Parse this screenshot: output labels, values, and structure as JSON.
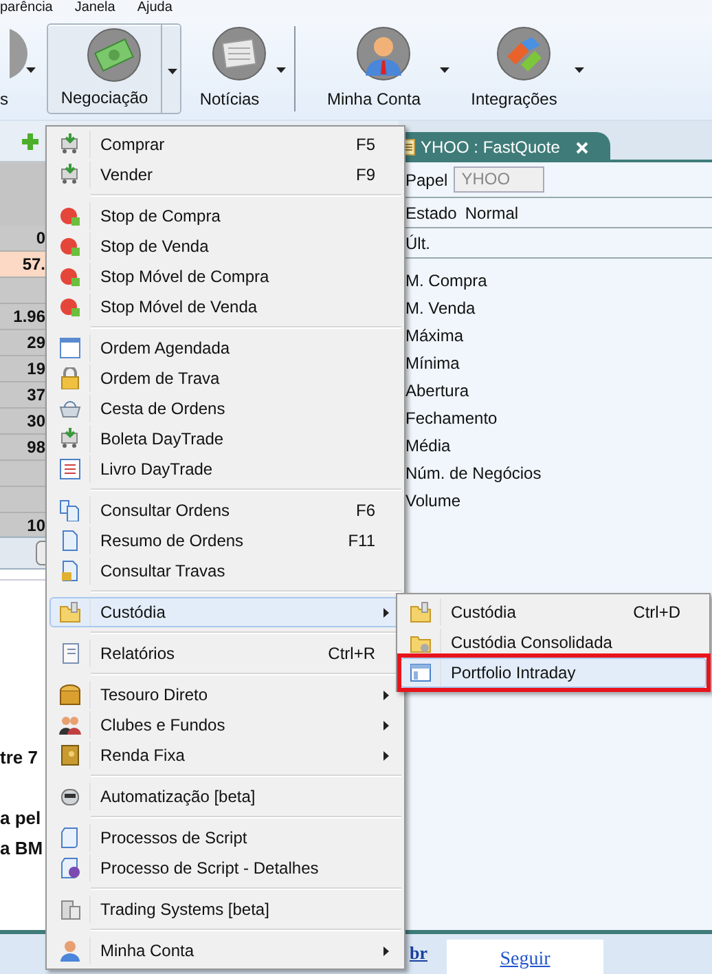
{
  "menu_bar": [
    "parência",
    "Janela",
    "Ajuda"
  ],
  "toolbar": [
    {
      "label": "s",
      "selected": false
    },
    {
      "label": "Negociação",
      "selected": true
    },
    {
      "label": "Notícias",
      "selected": false
    },
    {
      "label": "Minha Conta",
      "selected": false
    },
    {
      "label": "Integrações",
      "selected": false
    }
  ],
  "grid_rows": [
    {
      "text": "0",
      "highlighted": false
    },
    {
      "text": "57.",
      "highlighted": true
    },
    {
      "text": "",
      "highlighted": false
    },
    {
      "text": "1.96",
      "highlighted": false
    },
    {
      "text": "29",
      "highlighted": false
    },
    {
      "text": "19",
      "highlighted": false
    },
    {
      "text": "37",
      "highlighted": false
    },
    {
      "text": "30",
      "highlighted": false
    },
    {
      "text": "98",
      "highlighted": false
    },
    {
      "text": "",
      "highlighted": false
    },
    {
      "text": "",
      "highlighted": false
    },
    {
      "text": "10",
      "highlighted": false
    }
  ],
  "news_fragments": [
    "tre 7",
    "a pel",
    "a BM"
  ],
  "quote_panel": {
    "tab": "YHOO : FastQuote",
    "symbol_label": "Papel",
    "symbol_value": "YHOO",
    "state_label": "Estado",
    "state_value": "Normal",
    "last_label": "Últ.",
    "fields": [
      "M. Compra",
      "M. Venda",
      "Máxima",
      "Mínima",
      "Abertura",
      "Fechamento",
      "Média",
      "Núm. de Negócios",
      "Volume"
    ]
  },
  "context_menu": [
    [
      {
        "label": "Comprar",
        "shortcut": "F5",
        "submenu": false,
        "selected": false
      },
      {
        "label": "Vender",
        "shortcut": "F9",
        "submenu": false,
        "selected": false
      }
    ],
    [
      {
        "label": "Stop de Compra",
        "submenu": false,
        "selected": false
      },
      {
        "label": "Stop de Venda",
        "submenu": false,
        "selected": false
      },
      {
        "label": "Stop Móvel de Compra",
        "submenu": false,
        "selected": false
      },
      {
        "label": "Stop Móvel de Venda",
        "submenu": false,
        "selected": false
      }
    ],
    [
      {
        "label": "Ordem Agendada",
        "submenu": false,
        "selected": false
      },
      {
        "label": "Ordem de Trava",
        "submenu": false,
        "selected": false
      },
      {
        "label": "Cesta de Ordens",
        "submenu": false,
        "selected": false
      },
      {
        "label": "Boleta DayTrade",
        "submenu": false,
        "selected": false
      },
      {
        "label": "Livro DayTrade",
        "submenu": false,
        "selected": false
      }
    ],
    [
      {
        "label": "Consultar Ordens",
        "shortcut": "F6",
        "submenu": false,
        "selected": false
      },
      {
        "label": "Resumo de Ordens",
        "shortcut": "F11",
        "submenu": false,
        "selected": false
      },
      {
        "label": "Consultar Travas",
        "submenu": false,
        "selected": false
      }
    ],
    [
      {
        "label": "Custódia",
        "submenu": true,
        "selected": true
      }
    ],
    [
      {
        "label": "Relatórios",
        "shortcut": "Ctrl+R",
        "submenu": false,
        "selected": false
      }
    ],
    [
      {
        "label": "Tesouro Direto",
        "submenu": true,
        "selected": false
      },
      {
        "label": "Clubes e Fundos",
        "submenu": true,
        "selected": false
      },
      {
        "label": "Renda Fixa",
        "submenu": true,
        "selected": false
      }
    ],
    [
      {
        "label": "Automatização [beta]",
        "submenu": false,
        "selected": false
      }
    ],
    [
      {
        "label": "Processos de Script",
        "submenu": false,
        "selected": false
      },
      {
        "label": "Processo de Script - Detalhes",
        "submenu": false,
        "selected": false
      }
    ],
    [
      {
        "label": "Trading Systems [beta]",
        "submenu": false,
        "selected": false
      }
    ],
    [
      {
        "label": "Minha Conta",
        "submenu": true,
        "selected": false
      }
    ]
  ],
  "submenu": [
    {
      "label": "Custódia",
      "shortcut": "Ctrl+D",
      "selected": false,
      "outlined": false
    },
    {
      "label": "Custódia Consolidada",
      "selected": false,
      "outlined": false
    },
    {
      "label": "Portfolio Intraday",
      "selected": true,
      "outlined": true
    }
  ],
  "status_bar": {
    "link": "br",
    "follow_button": "Seguir"
  }
}
